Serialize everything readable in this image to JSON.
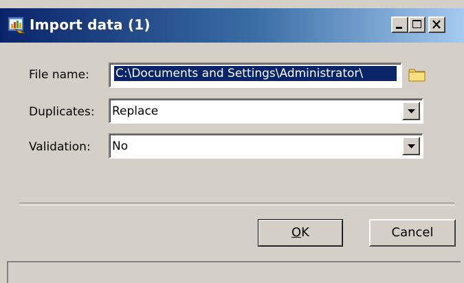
{
  "window": {
    "title": "Import data (1)",
    "title_icon": "import-data-icon"
  },
  "caption_buttons": {
    "minimize": "minimize-icon",
    "maximize": "maximize-icon",
    "close": "close-icon"
  },
  "form": {
    "file_name_label": "File name:",
    "file_name_value": "C:\\Documents and Settings\\Administrator\\",
    "browse_icon": "folder-icon",
    "duplicates_label": "Duplicates:",
    "duplicates_value": "Replace",
    "validation_label": "Validation:",
    "validation_value": "No"
  },
  "buttons": {
    "ok_label": "OK",
    "ok_mnemonic": "O",
    "ok_rest": "K",
    "cancel_label": "Cancel"
  },
  "colors": {
    "face": "#d4d0c8",
    "title_start": "#0a246a",
    "title_end": "#a6caf0",
    "selection": "#0a246a"
  }
}
